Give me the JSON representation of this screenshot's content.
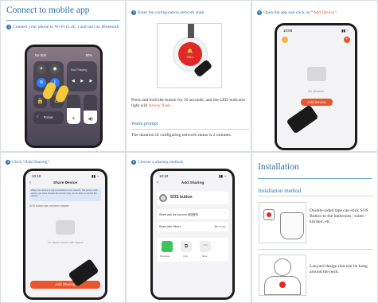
{
  "connect": {
    "title": "Connect to mobile app",
    "step1": "Connect your phone to Wi-Fi (2.4G ) and turn on Bluetooth.",
    "cc": {
      "carrier": "No SIM",
      "battery": "80%",
      "playing": "Not Playing",
      "focus": "Focus"
    }
  },
  "config": {
    "step2": "Enter the configuration network state.",
    "call_label": "CALL",
    "press_text_a": "Press and hold the button for 10 seconds, and the LED indicator light will ",
    "press_text_b": "slowly flash",
    "press_text_c": ".",
    "warn_title": "Warm prompt",
    "warn_text": "The duration of configuring network status is 2 minutes."
  },
  "add_device": {
    "step3": "Open the app and click on “",
    "step3_highlight": "Add Device",
    "step3_end": "”.",
    "time": "10:08",
    "no_devices": "No devices",
    "button": "Add Device"
  },
  "sharing": {
    "step4": "Click “Add Sharing”.",
    "time": "10:10",
    "header": "Share Device",
    "notice": "When the device is not connected to the network, the person with whom you have shared the device may not be able to control the device.",
    "empty_text": "SOS button has not been shared",
    "hint": "You haven't shared with anyone",
    "button": "Add Sharing"
  },
  "method": {
    "step5": "Choose a sharing method.",
    "time": "10:10",
    "header": "Add Sharing",
    "device": "SOS button",
    "row1": "Share with the Account 添加账号",
    "row2": "Share with Others",
    "row2_count": "5",
    "row2_unit": "person(s)",
    "apps": [
      "Messages",
      "Copy",
      "More"
    ]
  },
  "install": {
    "title": "Installation",
    "method_title": "Installation method",
    "tape_text": "Double-sided tape can stick SOS Button to the bathroom / toilet / kitchen, etc.",
    "lanyard_text": "Lanyard design that can be hung around the neck."
  }
}
